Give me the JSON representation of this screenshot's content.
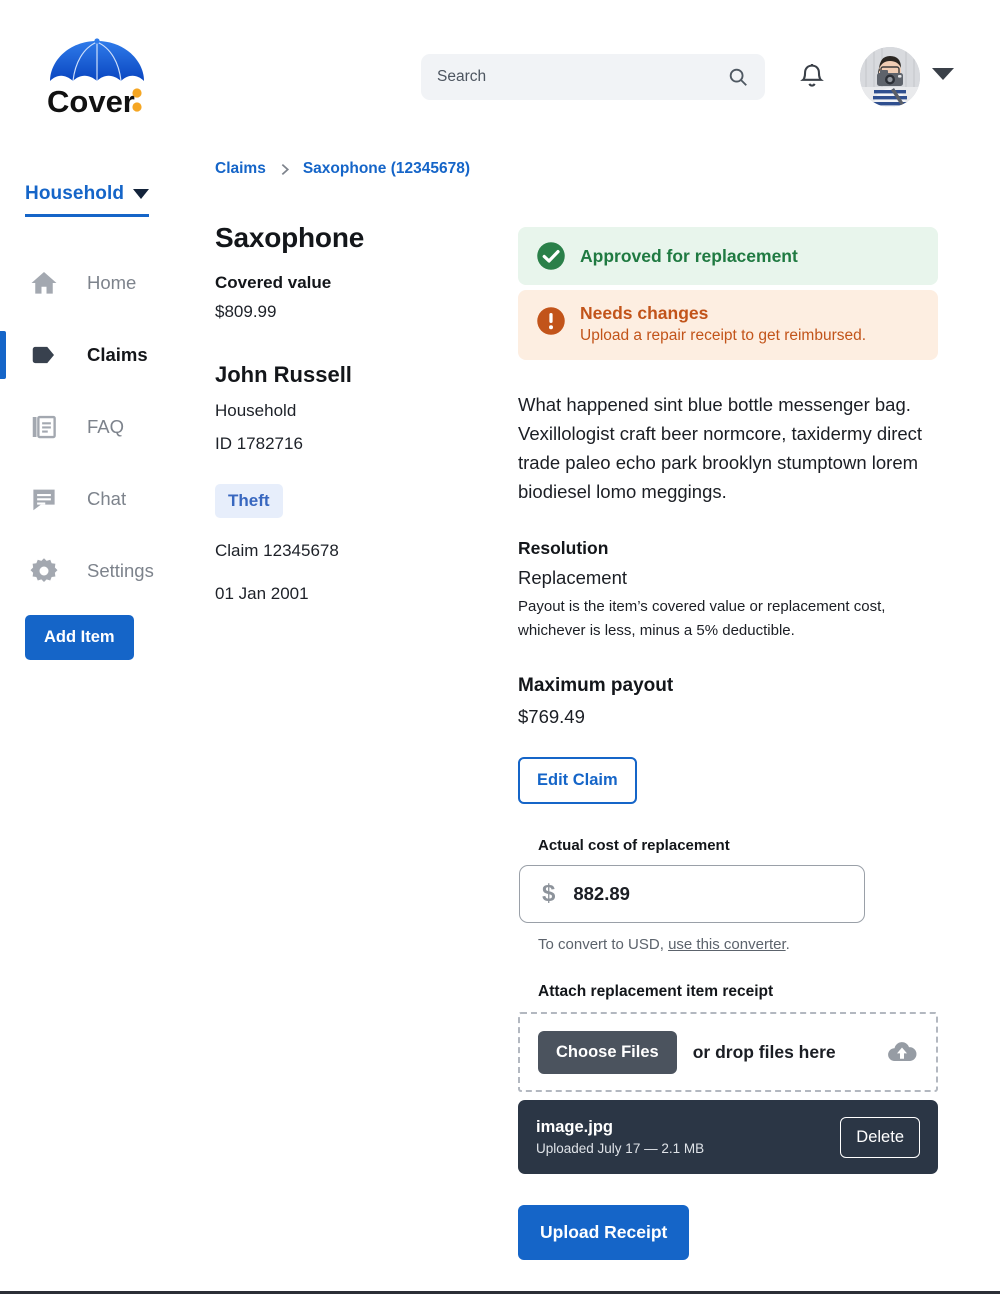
{
  "brand": {
    "name": "Cover",
    "accent_blue": "#1565c8",
    "accent_yellow": "#f5a623"
  },
  "header": {
    "search": {
      "placeholder": "Search",
      "value": ""
    },
    "search_icon": "search-icon",
    "bell_icon": "notification-bell-icon",
    "avatar_caret_icon": "chevron-down-icon"
  },
  "sidebar": {
    "scope_label": "Household",
    "items": [
      {
        "label": "Home",
        "icon": "home-icon",
        "active": false
      },
      {
        "label": "Claims",
        "icon": "tag-icon",
        "active": true
      },
      {
        "label": "FAQ",
        "icon": "documents-icon",
        "active": false
      },
      {
        "label": "Chat",
        "icon": "chat-bubble-icon",
        "active": false
      },
      {
        "label": "Settings",
        "icon": "gear-icon",
        "active": false
      }
    ],
    "add_item_label": "Add Item"
  },
  "breadcrumb": {
    "root": "Claims",
    "separator": "chevron-right-icon",
    "current": "Saxophone (12345678)"
  },
  "detail": {
    "item_title": "Saxophone",
    "covered_value_label": "Covered value",
    "covered_value": "$809.99",
    "owner_name": "John Russell",
    "owner_plan": "Household",
    "owner_id": "ID 1782716",
    "claim_type_badge": "Theft",
    "claim_number": "Claim 12345678",
    "claim_date": "01 Jan 2001"
  },
  "panel": {
    "banners": [
      {
        "kind": "success",
        "icon": "check-circle-icon",
        "title": "Approved for replacement",
        "subtitle": ""
      },
      {
        "kind": "warn",
        "icon": "alert-circle-icon",
        "title": "Needs changes",
        "subtitle": "Upload a repair receipt to get reimbursed."
      }
    ],
    "description": "What happened sint blue bottle messenger bag. Vexillologist craft beer normcore, taxidermy direct trade paleo echo park brooklyn stumptown lorem biodiesel lomo meggings.",
    "resolution_label": "Resolution",
    "resolution_value": "Replacement",
    "resolution_note": "Payout is the item’s covered value or replacement cost, whichever is less, minus a 5% deductible.",
    "max_payout_label": "Maximum payout",
    "max_payout_value": "$769.49",
    "edit_claim_label": "Edit Claim",
    "cost_field_label": "Actual cost of replacement",
    "cost_currency_symbol": "$",
    "cost_value": "882.89",
    "cost_placeholder": "0.00",
    "converter_note_prefix": "To convert to USD, ",
    "converter_link": "use this converter",
    "converter_note_suffix": ".",
    "attach_label": "Attach replacement item receipt",
    "choose_files_label": "Choose Files",
    "drop_text": "or drop files here",
    "upload_cloud_icon": "cloud-upload-icon",
    "file": {
      "name": "image.jpg",
      "meta": "Uploaded July 17 — 2.1 MB",
      "delete_label": "Delete"
    },
    "upload_receipt_label": "Upload Receipt"
  }
}
